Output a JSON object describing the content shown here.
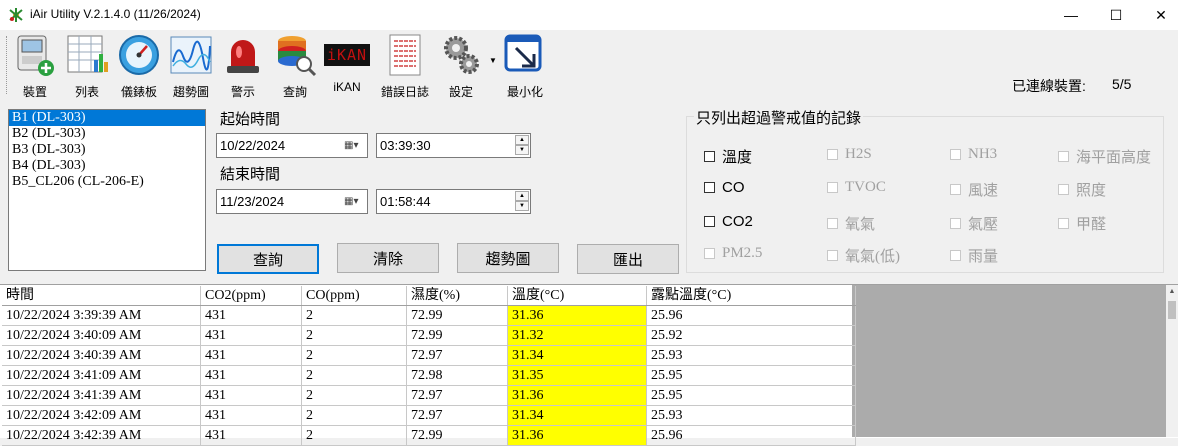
{
  "window": {
    "title": "iAir Utility V.2.1.4.0 (11/26/2024)",
    "minimize": "—",
    "maximize": "☐",
    "close": "✕"
  },
  "toolbar": {
    "items": [
      {
        "label": "裝置"
      },
      {
        "label": "列表"
      },
      {
        "label": "儀錶板"
      },
      {
        "label": "趨勢圖"
      },
      {
        "label": "警示"
      },
      {
        "label": "查詢"
      },
      {
        "label": "iKAN"
      },
      {
        "label": "錯誤日誌"
      },
      {
        "label": "設定"
      },
      {
        "label": "最小化"
      }
    ],
    "ikan_display": "iKAN",
    "connected_label": "已連線裝置:",
    "connected_value": "5/5"
  },
  "devices": [
    "B1 (DL-303)",
    "B2 (DL-303)",
    "B3 (DL-303)",
    "B4 (DL-303)",
    "B5_CL206 (CL-206-E)"
  ],
  "query": {
    "start_label": "起始時間",
    "start_date": "10/22/2024",
    "start_time": "03:39:30",
    "end_label": "結束時間",
    "end_date": "11/23/2024",
    "end_time": "01:58:44",
    "buttons": {
      "query": "查詢",
      "clear": "清除",
      "trend": "趨勢圖",
      "export": "匯出"
    }
  },
  "filter": {
    "title": "只列出超過警戒值的記錄",
    "options": [
      {
        "label": "溫度",
        "enabled": true
      },
      {
        "label": "H2S",
        "enabled": false
      },
      {
        "label": "NH3",
        "enabled": false
      },
      {
        "label": "海平面高度",
        "enabled": false
      },
      {
        "label": "CO",
        "enabled": true
      },
      {
        "label": "TVOC",
        "enabled": false
      },
      {
        "label": "風速",
        "enabled": false
      },
      {
        "label": "照度",
        "enabled": false
      },
      {
        "label": "CO2",
        "enabled": true
      },
      {
        "label": "氧氣",
        "enabled": false
      },
      {
        "label": "氣壓",
        "enabled": false
      },
      {
        "label": "甲醛",
        "enabled": false
      },
      {
        "label": "PM2.5",
        "enabled": false
      },
      {
        "label": "氧氣(低)",
        "enabled": false
      },
      {
        "label": "雨量",
        "enabled": false
      }
    ]
  },
  "table": {
    "columns": [
      "時間",
      "CO2(ppm)",
      "CO(ppm)",
      "濕度(%)",
      "溫度(°C)",
      "露點溫度(°C)"
    ],
    "rows": [
      [
        "10/22/2024 3:39:39 AM",
        "431",
        "2",
        "72.99",
        "31.36",
        "25.96"
      ],
      [
        "10/22/2024 3:40:09 AM",
        "431",
        "2",
        "72.99",
        "31.32",
        "25.92"
      ],
      [
        "10/22/2024 3:40:39 AM",
        "431",
        "2",
        "72.97",
        "31.34",
        "25.93"
      ],
      [
        "10/22/2024 3:41:09 AM",
        "431",
        "2",
        "72.98",
        "31.35",
        "25.95"
      ],
      [
        "10/22/2024 3:41:39 AM",
        "431",
        "2",
        "72.97",
        "31.36",
        "25.95"
      ],
      [
        "10/22/2024 3:42:09 AM",
        "431",
        "2",
        "72.97",
        "31.34",
        "25.93"
      ],
      [
        "10/22/2024 3:42:39 AM",
        "431",
        "2",
        "72.99",
        "31.36",
        "25.96"
      ]
    ],
    "highlight_color": "#ffff00"
  }
}
